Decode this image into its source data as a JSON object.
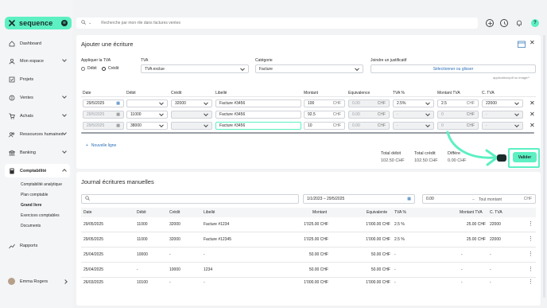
{
  "app": {
    "name": "sequence",
    "user": "Emma Rogers",
    "avatar_initial": "?"
  },
  "sidebar": {
    "items": [
      {
        "label": "Dashboard",
        "icon": "dashboard-icon"
      },
      {
        "label": "Mon espace",
        "icon": "user-icon"
      },
      {
        "label": "Projets",
        "icon": "checkbox-icon"
      },
      {
        "label": "Ventes",
        "icon": "sales-icon"
      },
      {
        "label": "Achats",
        "icon": "cart-icon"
      },
      {
        "label": "Ressources humaines",
        "icon": "people-icon"
      },
      {
        "label": "Banking",
        "icon": "bank-icon"
      },
      {
        "label": "Comptabilité",
        "icon": "calculator-icon"
      },
      {
        "label": "Rapports",
        "icon": "chart-icon"
      }
    ],
    "sub_items": [
      "Comptabilité analytique",
      "Plan comptable",
      "Grand livre",
      "Exercices comptables",
      "Documents"
    ]
  },
  "search": {
    "placeholder": "Recherche par mon·rile dans factures ventes"
  },
  "add_entry": {
    "title": "Ajouter une écriture",
    "apply_tva_label": "Appliquer la TVA",
    "apply_tva_options": [
      "Débit",
      "Crédit"
    ],
    "tva_label": "TVA",
    "tva_value": "TVA exclue",
    "category_label": "Catégorie",
    "category_value": "Facture",
    "attach_label": "Joindre un justificatif",
    "attach_button": "Sélectionner ou glisser",
    "attach_hint": "application/pdf ou image/*",
    "columns": [
      "Date",
      "Débit",
      "Crédit",
      "Libellé",
      "Montant",
      "Equivalence",
      "TVA %",
      "Montant TVA",
      "C. TVA"
    ],
    "rows": [
      {
        "date": "29/5/2025",
        "debit": "",
        "credit": "32000",
        "libelle": "Facture #3456",
        "montant": "100",
        "currency": "CHF",
        "equivalence": "0.00",
        "eq_currency": "CHF",
        "tva": "2.5%",
        "montant_tva": "2.5",
        "tva_currency": "CHF",
        "c_tva": "22000"
      },
      {
        "date": "29/5/2025",
        "debit": "11000",
        "credit": "",
        "libelle": "Facture #3456",
        "montant": "92.5",
        "currency": "CHF",
        "equivalence": "0.00",
        "eq_currency": "CHF",
        "tva": "-",
        "montant_tva": "0",
        "tva_currency": "CHF",
        "c_tva": "-"
      },
      {
        "date": "29/5/2025",
        "debit": "38000",
        "credit": "",
        "libelle": "Facture #3456",
        "montant": "10",
        "currency": "CHF",
        "equivalence": "0.00",
        "eq_currency": "CHF",
        "tva": "-",
        "montant_tva": "0",
        "tva_currency": "CHF",
        "c_tva": "-"
      }
    ],
    "new_line": "Nouvelle ligne",
    "totals": [
      {
        "label": "Total débit",
        "value": "102.50 CHF"
      },
      {
        "label": "Total crédit",
        "value": "102.50 CHF"
      },
      {
        "label": "Différe",
        "value": "0.00 CHF"
      }
    ],
    "validate": "Valider"
  },
  "journal": {
    "title": "Journal écritures manuelles",
    "date_range": "1/1/2023 – 29/5/2025",
    "amount_min": "0.00",
    "amount_placeholder": "Tout montant",
    "currency": "CHF",
    "columns": [
      "Date",
      "Débit",
      "Crédit",
      "Libellé",
      "Montant",
      "Equivalente",
      "TVA %",
      "Montant TVA",
      "C. TVA"
    ],
    "rows": [
      {
        "date": "29/05/2025",
        "debit": "11000",
        "credit": "32000",
        "libelle": "Facture #1234",
        "montant": "1'025.00 CHF",
        "equiv": "1'000.00 CHF",
        "tva": "2.5 %",
        "montant_tva": "25.00 CHF",
        "c_tva": "22000"
      },
      {
        "date": "29/05/2025",
        "debit": "11000",
        "credit": "32000",
        "libelle": "Facture #12345",
        "montant": "1'025.00 CHF",
        "equiv": "1'000.00 CHF",
        "tva": "2.5 %",
        "montant_tva": "25.00 CHF",
        "c_tva": "22000"
      },
      {
        "date": "25/04/2025",
        "debit": "10000",
        "credit": "-",
        "libelle": "-",
        "montant": "50.00 CHF",
        "equiv": "50.00 CHF",
        "tva": "-",
        "montant_tva": "-",
        "c_tva": "-"
      },
      {
        "date": "25/04/2025",
        "debit": "-",
        "credit": "10000",
        "libelle": "1234",
        "montant": "50.00 CHF",
        "equiv": "50.00 CHF",
        "tva": "-",
        "montant_tva": "-",
        "c_tva": "-"
      },
      {
        "date": "26/03/2025",
        "debit": "10100",
        "credit": "-",
        "libelle": "-",
        "montant": "1'000.00 CHF",
        "equiv": "1'000.00 CHF",
        "tva": "-",
        "montant_tva": "-",
        "c_tva": "-"
      }
    ]
  },
  "colors": {
    "accent": "#5cf0c2",
    "dark": "#1b2a2a"
  }
}
